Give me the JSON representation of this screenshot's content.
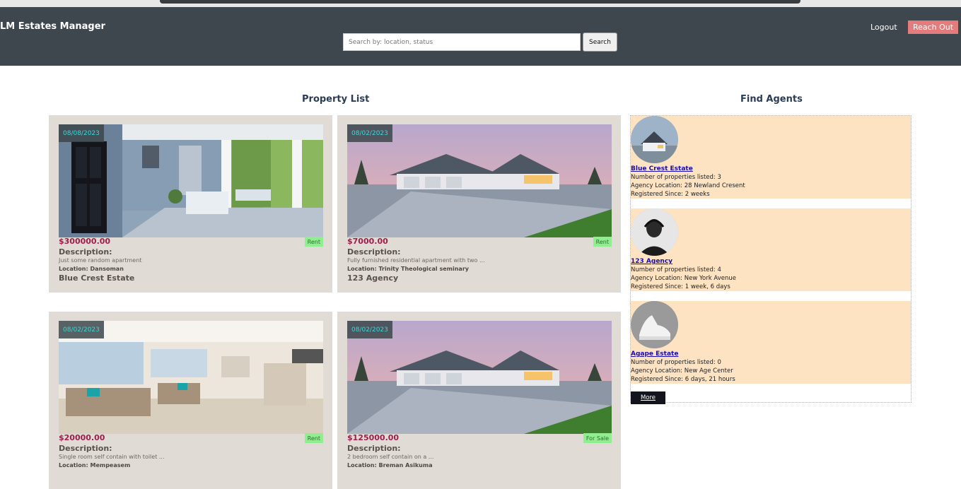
{
  "header": {
    "brand": "LM Estates Manager",
    "search_placeholder": "Search by: location, status",
    "search_label": "Search",
    "logout_label": "Logout",
    "reach_label": "Reach Out"
  },
  "colors": {
    "header_bg": "#3f474e",
    "card_bg": "#e0dbd5",
    "agent_bg": "#fde3c2",
    "price": "#a01d4c",
    "status_bg": "#90ee90",
    "reach_bg": "#e37c7c"
  },
  "properties_title": "Property List",
  "agents_title": "Find Agents",
  "properties": [
    {
      "date": "08/08/2023",
      "price": "$300000.00",
      "status": "Rent",
      "desc_label": "Description:",
      "description": "Just some random apartment",
      "location": "Location: Dansoman",
      "agency": "Blue Crest Estate",
      "image": "porch-photo"
    },
    {
      "date": "08/02/2023",
      "price": "$7000.00",
      "status": "Rent",
      "desc_label": "Description:",
      "description": "Fully furnished residential apartment with two ...",
      "location": "Location: Trinity Theological seminary",
      "agency": "123 Agency",
      "image": "house-photo"
    },
    {
      "date": "08/02/2023",
      "price": "$20000.00",
      "status": "Rent",
      "desc_label": "Description:",
      "description": "Single room self contain with toilet ...",
      "location": "Location: Mempeasem",
      "agency": "",
      "image": "living-room-photo"
    },
    {
      "date": "08/02/2023",
      "price": "$125000.00",
      "status": "For Sale",
      "desc_label": "Description:",
      "description": "2 bedroom self contain on a ...",
      "location": "Location: Breman Asikuma",
      "agency": "",
      "image": "house-photo"
    }
  ],
  "agents": [
    {
      "name": "Blue Crest Estate",
      "properties": "Number of properties listed: 3",
      "location": "Agency Location: 28 Newland Cresent",
      "registered": "Registered Since: 2 weeks",
      "avatar": "house-avatar"
    },
    {
      "name": "123 Agency",
      "properties": "Number of properties listed: 4",
      "location": "Agency Location: New York Avenue",
      "registered": "Registered Since: 1 week, 6 days",
      "avatar": "person-avatar"
    },
    {
      "name": "Agape Estate",
      "properties": "Number of properties listed: 0",
      "location": "Agency Location: New Age Center",
      "registered": "Registered Since: 6 days, 21 hours",
      "avatar": "sneakers-avatar"
    }
  ],
  "more_label": "More"
}
